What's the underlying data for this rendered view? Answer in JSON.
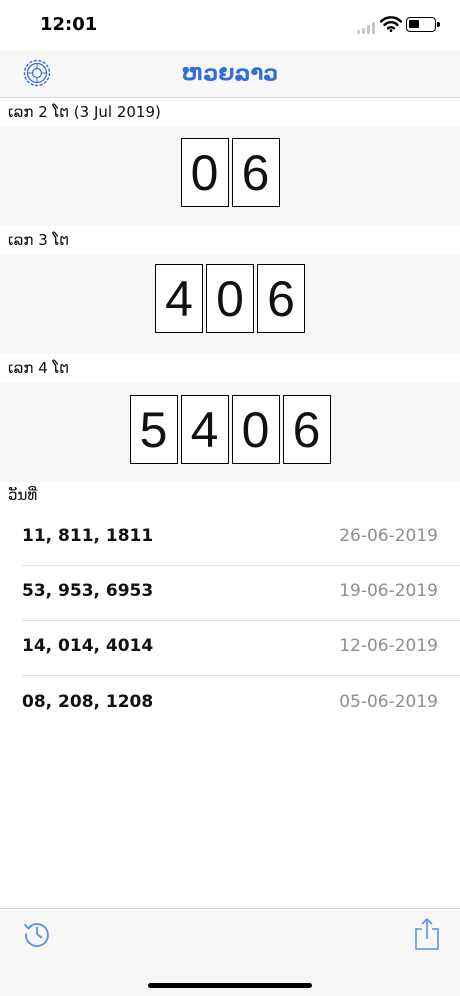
{
  "status_bar": {
    "time": "12:01",
    "icons": [
      "cellular-signal-icon",
      "wifi-icon",
      "battery-icon"
    ]
  },
  "nav": {
    "title": "ຫວຍລາວ",
    "left_icon": "settings-gear-icon",
    "accent_color": "#2f6fd6"
  },
  "sections": {
    "two_digit": {
      "label": "ເລກ 2 ໂຕ (3 Jul 2019)",
      "digits": [
        "0",
        "6"
      ]
    },
    "three_digit": {
      "label": "ເລກ 3 ໂຕ",
      "digits": [
        "4",
        "0",
        "6"
      ]
    },
    "four_digit": {
      "label": "ເລກ 4 ໂຕ",
      "digits": [
        "5",
        "4",
        "0",
        "6"
      ]
    },
    "date_header": "ວັນທີ່"
  },
  "history": [
    {
      "numbers": "11, 811, 1811",
      "date": "26-06-2019"
    },
    {
      "numbers": "53, 953, 6953",
      "date": "19-06-2019"
    },
    {
      "numbers": "14, 014, 4014",
      "date": "12-06-2019"
    },
    {
      "numbers": "08, 208, 1208",
      "date": "05-06-2019"
    }
  ],
  "toolbar": {
    "left_icon": "history-icon",
    "right_icon": "share-icon"
  }
}
